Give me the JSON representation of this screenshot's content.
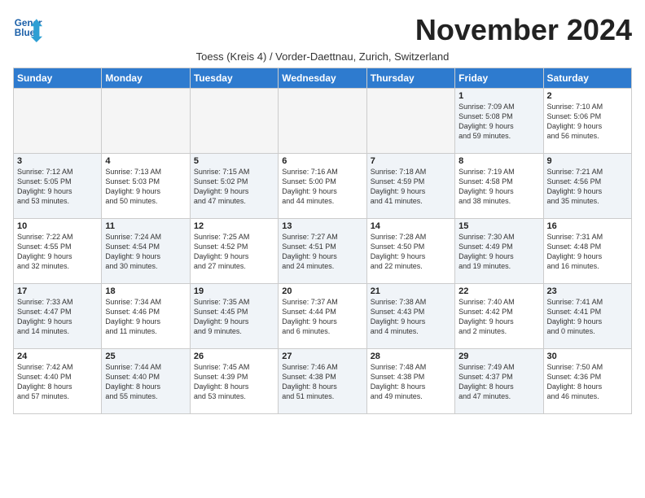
{
  "header": {
    "logo_line1": "General",
    "logo_line2": "Blue",
    "month": "November 2024",
    "subtitle": "Toess (Kreis 4) / Vorder-Daettnau, Zurich, Switzerland"
  },
  "days_of_week": [
    "Sunday",
    "Monday",
    "Tuesday",
    "Wednesday",
    "Thursday",
    "Friday",
    "Saturday"
  ],
  "weeks": [
    [
      {
        "num": "",
        "info": "",
        "shaded": false,
        "empty": true
      },
      {
        "num": "",
        "info": "",
        "shaded": false,
        "empty": true
      },
      {
        "num": "",
        "info": "",
        "shaded": false,
        "empty": true
      },
      {
        "num": "",
        "info": "",
        "shaded": false,
        "empty": true
      },
      {
        "num": "",
        "info": "",
        "shaded": false,
        "empty": true
      },
      {
        "num": "1",
        "info": "Sunrise: 7:09 AM\nSunset: 5:08 PM\nDaylight: 9 hours\nand 59 minutes.",
        "shaded": true,
        "empty": false
      },
      {
        "num": "2",
        "info": "Sunrise: 7:10 AM\nSunset: 5:06 PM\nDaylight: 9 hours\nand 56 minutes.",
        "shaded": false,
        "empty": false
      }
    ],
    [
      {
        "num": "3",
        "info": "Sunrise: 7:12 AM\nSunset: 5:05 PM\nDaylight: 9 hours\nand 53 minutes.",
        "shaded": true,
        "empty": false
      },
      {
        "num": "4",
        "info": "Sunrise: 7:13 AM\nSunset: 5:03 PM\nDaylight: 9 hours\nand 50 minutes.",
        "shaded": false,
        "empty": false
      },
      {
        "num": "5",
        "info": "Sunrise: 7:15 AM\nSunset: 5:02 PM\nDaylight: 9 hours\nand 47 minutes.",
        "shaded": true,
        "empty": false
      },
      {
        "num": "6",
        "info": "Sunrise: 7:16 AM\nSunset: 5:00 PM\nDaylight: 9 hours\nand 44 minutes.",
        "shaded": false,
        "empty": false
      },
      {
        "num": "7",
        "info": "Sunrise: 7:18 AM\nSunset: 4:59 PM\nDaylight: 9 hours\nand 41 minutes.",
        "shaded": true,
        "empty": false
      },
      {
        "num": "8",
        "info": "Sunrise: 7:19 AM\nSunset: 4:58 PM\nDaylight: 9 hours\nand 38 minutes.",
        "shaded": false,
        "empty": false
      },
      {
        "num": "9",
        "info": "Sunrise: 7:21 AM\nSunset: 4:56 PM\nDaylight: 9 hours\nand 35 minutes.",
        "shaded": true,
        "empty": false
      }
    ],
    [
      {
        "num": "10",
        "info": "Sunrise: 7:22 AM\nSunset: 4:55 PM\nDaylight: 9 hours\nand 32 minutes.",
        "shaded": false,
        "empty": false
      },
      {
        "num": "11",
        "info": "Sunrise: 7:24 AM\nSunset: 4:54 PM\nDaylight: 9 hours\nand 30 minutes.",
        "shaded": true,
        "empty": false
      },
      {
        "num": "12",
        "info": "Sunrise: 7:25 AM\nSunset: 4:52 PM\nDaylight: 9 hours\nand 27 minutes.",
        "shaded": false,
        "empty": false
      },
      {
        "num": "13",
        "info": "Sunrise: 7:27 AM\nSunset: 4:51 PM\nDaylight: 9 hours\nand 24 minutes.",
        "shaded": true,
        "empty": false
      },
      {
        "num": "14",
        "info": "Sunrise: 7:28 AM\nSunset: 4:50 PM\nDaylight: 9 hours\nand 22 minutes.",
        "shaded": false,
        "empty": false
      },
      {
        "num": "15",
        "info": "Sunrise: 7:30 AM\nSunset: 4:49 PM\nDaylight: 9 hours\nand 19 minutes.",
        "shaded": true,
        "empty": false
      },
      {
        "num": "16",
        "info": "Sunrise: 7:31 AM\nSunset: 4:48 PM\nDaylight: 9 hours\nand 16 minutes.",
        "shaded": false,
        "empty": false
      }
    ],
    [
      {
        "num": "17",
        "info": "Sunrise: 7:33 AM\nSunset: 4:47 PM\nDaylight: 9 hours\nand 14 minutes.",
        "shaded": true,
        "empty": false
      },
      {
        "num": "18",
        "info": "Sunrise: 7:34 AM\nSunset: 4:46 PM\nDaylight: 9 hours\nand 11 minutes.",
        "shaded": false,
        "empty": false
      },
      {
        "num": "19",
        "info": "Sunrise: 7:35 AM\nSunset: 4:45 PM\nDaylight: 9 hours\nand 9 minutes.",
        "shaded": true,
        "empty": false
      },
      {
        "num": "20",
        "info": "Sunrise: 7:37 AM\nSunset: 4:44 PM\nDaylight: 9 hours\nand 6 minutes.",
        "shaded": false,
        "empty": false
      },
      {
        "num": "21",
        "info": "Sunrise: 7:38 AM\nSunset: 4:43 PM\nDaylight: 9 hours\nand 4 minutes.",
        "shaded": true,
        "empty": false
      },
      {
        "num": "22",
        "info": "Sunrise: 7:40 AM\nSunset: 4:42 PM\nDaylight: 9 hours\nand 2 minutes.",
        "shaded": false,
        "empty": false
      },
      {
        "num": "23",
        "info": "Sunrise: 7:41 AM\nSunset: 4:41 PM\nDaylight: 9 hours\nand 0 minutes.",
        "shaded": true,
        "empty": false
      }
    ],
    [
      {
        "num": "24",
        "info": "Sunrise: 7:42 AM\nSunset: 4:40 PM\nDaylight: 8 hours\nand 57 minutes.",
        "shaded": false,
        "empty": false
      },
      {
        "num": "25",
        "info": "Sunrise: 7:44 AM\nSunset: 4:40 PM\nDaylight: 8 hours\nand 55 minutes.",
        "shaded": true,
        "empty": false
      },
      {
        "num": "26",
        "info": "Sunrise: 7:45 AM\nSunset: 4:39 PM\nDaylight: 8 hours\nand 53 minutes.",
        "shaded": false,
        "empty": false
      },
      {
        "num": "27",
        "info": "Sunrise: 7:46 AM\nSunset: 4:38 PM\nDaylight: 8 hours\nand 51 minutes.",
        "shaded": true,
        "empty": false
      },
      {
        "num": "28",
        "info": "Sunrise: 7:48 AM\nSunset: 4:38 PM\nDaylight: 8 hours\nand 49 minutes.",
        "shaded": false,
        "empty": false
      },
      {
        "num": "29",
        "info": "Sunrise: 7:49 AM\nSunset: 4:37 PM\nDaylight: 8 hours\nand 47 minutes.",
        "shaded": true,
        "empty": false
      },
      {
        "num": "30",
        "info": "Sunrise: 7:50 AM\nSunset: 4:36 PM\nDaylight: 8 hours\nand 46 minutes.",
        "shaded": false,
        "empty": false
      }
    ]
  ]
}
